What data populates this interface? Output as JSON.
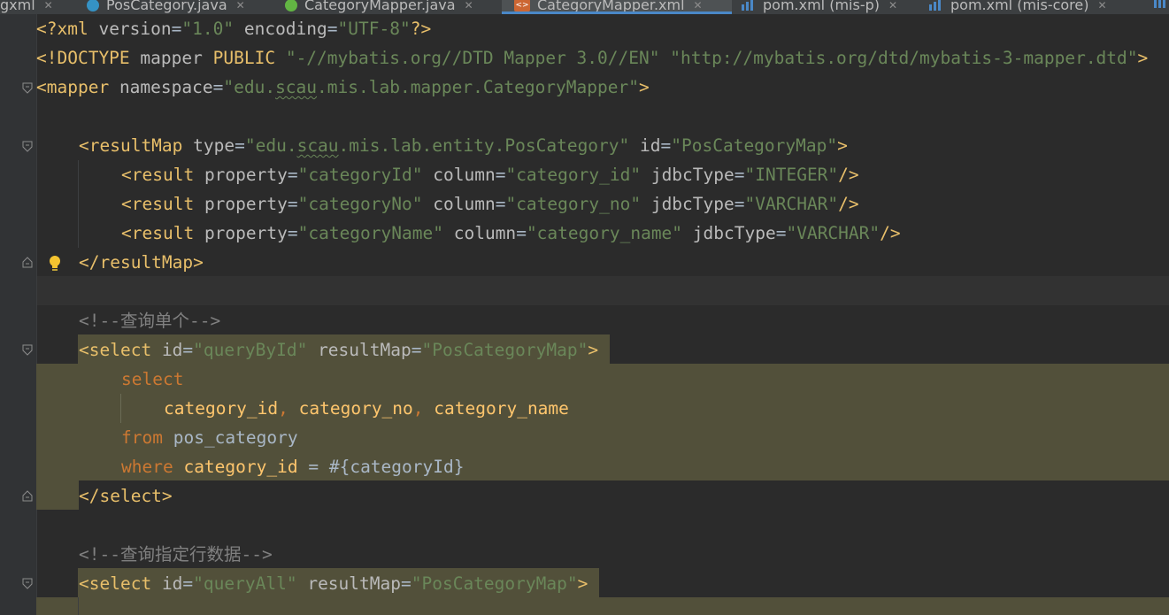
{
  "tabs": [
    {
      "label": "gxml",
      "icon": "none",
      "active": false
    },
    {
      "label": "PosCategory.java",
      "icon": "class-icon",
      "active": false
    },
    {
      "label": "CategoryMapper.java",
      "icon": "interface-icon",
      "active": false
    },
    {
      "label": "CategoryMapper.xml",
      "icon": "xml-file-icon",
      "active": true
    },
    {
      "label": "pom.xml (mis-p)",
      "icon": "maven-icon",
      "active": false
    },
    {
      "label": "pom.xml (mis-core)",
      "icon": "maven-icon",
      "active": false
    }
  ],
  "colors": {
    "background": "#2b2b2b",
    "gutter": "#313335",
    "highlight": "#52503a",
    "tag": "#e8bf6a",
    "attribute_value": "#6a8759",
    "keyword": "#cc7832",
    "comment": "#808080",
    "active_tab_underline": "#4a88c7"
  },
  "code": {
    "l1": {
      "open": "<?xml",
      "a1": "version",
      "v1": "\"1.0\"",
      "a2": "encoding",
      "v2": "\"UTF-8\"",
      "close": "?>"
    },
    "l2": {
      "open": "<!DOCTYPE",
      "w1": "mapper",
      "w2": "PUBLIC",
      "v1": "\"-//mybatis.org//DTD Mapper 3.0//EN\"",
      "v2": "\"http://mybatis.org/dtd/mybatis-3-mapper.dtd\"",
      "close": ">"
    },
    "l3": {
      "open": "<mapper",
      "a1": "namespace",
      "v1a": "\"edu.",
      "v1b": "scau",
      "v1c": ".mis.lab.mapper.CategoryMapper\"",
      "close": ">"
    },
    "l5": {
      "open": "<resultMap",
      "a1": "type",
      "v1a": "\"edu.",
      "v1b": "scau",
      "v1c": ".mis.lab.entity.PosCategory\"",
      "a2": "id",
      "v2": "\"PosCategoryMap\"",
      "close": ">"
    },
    "l6": {
      "open": "<result",
      "a1": "property",
      "v1": "\"categoryId\"",
      "a2": "column",
      "v2": "\"category_id\"",
      "a3": "jdbcType",
      "v3": "\"INTEGER\"",
      "close": "/>"
    },
    "l7": {
      "open": "<result",
      "a1": "property",
      "v1": "\"categoryNo\"",
      "a2": "column",
      "v2": "\"category_no\"",
      "a3": "jdbcType",
      "v3": "\"VARCHAR\"",
      "close": "/>"
    },
    "l8": {
      "open": "<result",
      "a1": "property",
      "v1": "\"categoryName\"",
      "a2": "column",
      "v2": "\"category_name\"",
      "a3": "jdbcType",
      "v3": "\"VARCHAR\"",
      "close": "/>"
    },
    "l9": {
      "tag": "</resultMap>"
    },
    "l11": {
      "comment": "<!--查询单个-->"
    },
    "l12": {
      "open": "<select",
      "a1": "id",
      "v1": "\"queryById\"",
      "a2": "resultMap",
      "v2": "\"PosCategoryMap\"",
      "close": ">"
    },
    "l13": {
      "kw": "select"
    },
    "l14": {
      "c1": "category_id",
      "s1": ",",
      "c2": "category_no",
      "s2": ",",
      "c3": "category_name"
    },
    "l15": {
      "kw": "from",
      "table": "pos_category"
    },
    "l16": {
      "kw": "where",
      "col": "category_id",
      "op": "=",
      "param": "#{categoryId}"
    },
    "l17": {
      "tag": "</select>"
    },
    "l19": {
      "comment": "<!--查询指定行数据-->"
    },
    "l20": {
      "open": "<select",
      "a1": "id",
      "v1": "\"queryAll\"",
      "a2": "resultMap",
      "v2": "\"PosCategoryMap\"",
      "close": ">"
    }
  }
}
